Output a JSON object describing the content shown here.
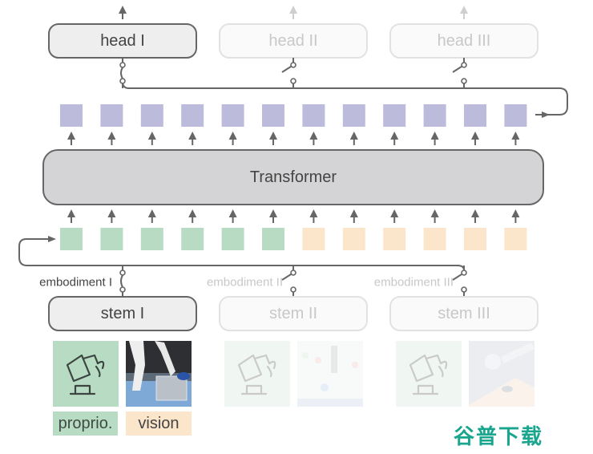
{
  "colors": {
    "active_stroke": "#666666",
    "active_fill": "#eeeeee",
    "inactive_stroke": "#e2e2e2",
    "inactive_fill": "#fafafa",
    "inactive_text": "#c8c8c8",
    "active_text": "#444444",
    "transformer_fill": "#d4d4d6",
    "output_token": "#bcbbdc",
    "proprio_token": "#b7dcc3",
    "vision_token": "#fbe6cc",
    "watermark": "#1aa58e"
  },
  "heads": [
    {
      "label": "head I",
      "active": true
    },
    {
      "label": "head II",
      "active": false
    },
    {
      "label": "head III",
      "active": false
    }
  ],
  "transformer": {
    "label": "Transformer"
  },
  "output_tokens": {
    "count": 12
  },
  "input_tokens": {
    "proprio_count": 6,
    "vision_count": 6
  },
  "embodiments": [
    {
      "label": "embodiment I",
      "active": true
    },
    {
      "label": "embodiment II",
      "active": false
    },
    {
      "label": "embodiment III",
      "active": false
    }
  ],
  "stems": [
    {
      "label": "stem I",
      "active": true
    },
    {
      "label": "stem II",
      "active": false
    },
    {
      "label": "stem III",
      "active": false
    }
  ],
  "inputs": [
    {
      "proprio_icon": "robot-arm-icon",
      "vision_image": "robot-scene-image",
      "active": true
    },
    {
      "proprio_icon": "robot-arm-icon",
      "vision_image": "robot-scene-image",
      "active": false
    },
    {
      "proprio_icon": "robot-arm-icon",
      "vision_image": "robot-scene-image",
      "active": false
    }
  ],
  "modality_labels": {
    "proprio": "proprio.",
    "vision": "vision"
  },
  "watermark": "谷普下载"
}
